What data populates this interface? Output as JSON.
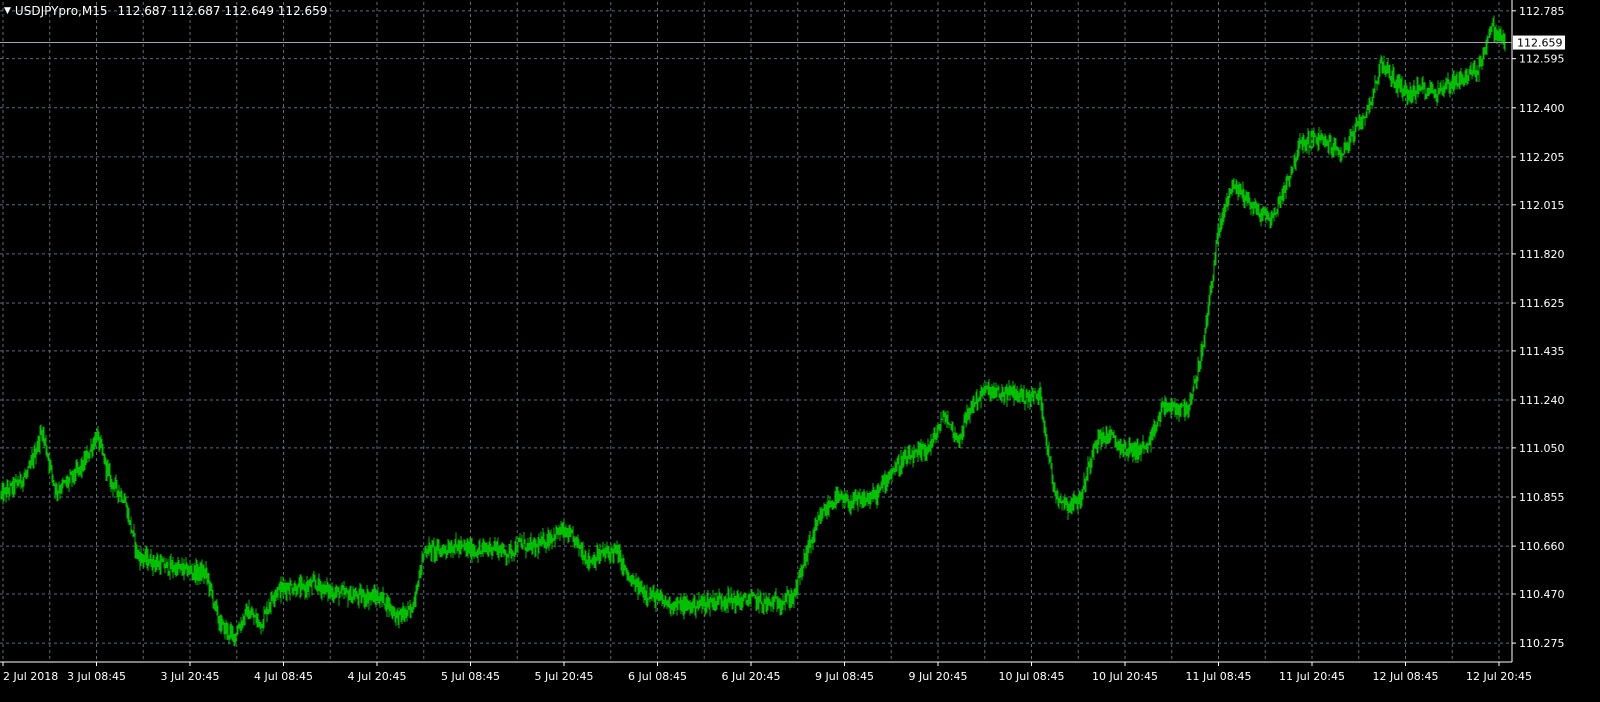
{
  "window": {
    "symbol_title": "USDJPYpro,M15",
    "ohlc": "112.687 112.687 112.649 112.659",
    "collapse_icon": "triangle-down-icon"
  },
  "colors": {
    "background": "#000000",
    "grid": "#5a6e7a",
    "price_line": "#00c000",
    "axis_text": "#ffffff",
    "current_price_line": "#a0a8b0"
  },
  "chart_data": {
    "type": "line",
    "title": "",
    "xlabel": "",
    "ylabel": "",
    "ylim": [
      110.2,
      112.82
    ],
    "current_price": 112.659,
    "current_price_label": "112.659",
    "y_ticks": [
      {
        "value": 112.785,
        "label": "112.785"
      },
      {
        "value": 112.595,
        "label": "112.595"
      },
      {
        "value": 112.4,
        "label": "112.400"
      },
      {
        "value": 112.205,
        "label": "112.205"
      },
      {
        "value": 112.015,
        "label": "112.015"
      },
      {
        "value": 111.82,
        "label": "111.820"
      },
      {
        "value": 111.625,
        "label": "111.625"
      },
      {
        "value": 111.435,
        "label": "111.435"
      },
      {
        "value": 111.24,
        "label": "111.240"
      },
      {
        "value": 111.05,
        "label": "111.050"
      },
      {
        "value": 110.855,
        "label": "110.855"
      },
      {
        "value": 110.66,
        "label": "110.660"
      },
      {
        "value": 110.47,
        "label": "110.470"
      },
      {
        "value": 110.275,
        "label": "110.275"
      }
    ],
    "x_ticks": [
      "2 Jul 2018",
      "3 Jul 08:45",
      "3 Jul 20:45",
      "4 Jul 08:45",
      "4 Jul 20:45",
      "5 Jul 08:45",
      "5 Jul 20:45",
      "6 Jul 08:45",
      "6 Jul 20:45",
      "9 Jul 08:45",
      "9 Jul 20:45",
      "10 Jul 08:45",
      "10 Jul 20:45",
      "11 Jul 08:45",
      "11 Jul 20:45",
      "12 Jul 08:45",
      "12 Jul 20:45"
    ],
    "grid": true,
    "series": [
      {
        "values": [
          110.86,
          110.9,
          110.95,
          111.12,
          110.88,
          110.92,
          110.98,
          111.1,
          110.92,
          110.85,
          110.62,
          110.6,
          110.58,
          110.57,
          110.56,
          110.55,
          110.35,
          110.3,
          110.4,
          110.35,
          110.48,
          110.5,
          110.49,
          110.51,
          110.48,
          110.47,
          110.46,
          110.46,
          110.45,
          110.38,
          110.4,
          110.65,
          110.64,
          110.66,
          110.65,
          110.64,
          110.66,
          110.63,
          110.67,
          110.65,
          110.69,
          110.72,
          110.68,
          110.6,
          110.63,
          110.64,
          110.52,
          110.48,
          110.45,
          110.43,
          110.42,
          110.43,
          110.44,
          110.45,
          110.44,
          110.45,
          110.43,
          110.44,
          110.46,
          110.65,
          110.78,
          110.85,
          110.83,
          110.84,
          110.86,
          110.95,
          111.0,
          111.02,
          111.06,
          111.18,
          111.08,
          111.22,
          111.28,
          111.26,
          111.27,
          111.25,
          111.26,
          110.88,
          110.82,
          110.85,
          111.08,
          111.1,
          111.05,
          111.04,
          111.06,
          111.22,
          111.2,
          111.22,
          111.48,
          111.9,
          112.1,
          112.05,
          111.98,
          111.96,
          112.1,
          112.25,
          112.28,
          112.26,
          112.22,
          112.3,
          112.4,
          112.58,
          112.5,
          112.45,
          112.48,
          112.46,
          112.5,
          112.52,
          112.55,
          112.72,
          112.66
        ]
      }
    ]
  }
}
